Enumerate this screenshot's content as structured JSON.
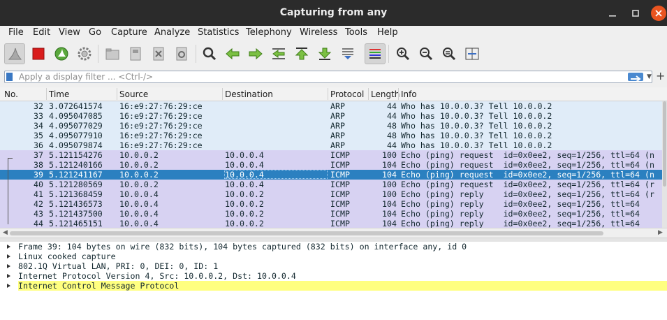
{
  "window": {
    "title": "Capturing from any"
  },
  "menu": [
    "File",
    "Edit",
    "View",
    "Go",
    "Capture",
    "Analyze",
    "Statistics",
    "Telephony",
    "Wireless",
    "Tools",
    "Help"
  ],
  "toolbar": {
    "icons": [
      "shark-fin-start-icon",
      "stop-square-icon",
      "restart-shark-icon",
      "capture-options-gear-icon",
      "open-folder-icon",
      "save-file-icon",
      "close-file-icon",
      "reload-file-icon",
      "find-packet-icon",
      "go-back-icon",
      "go-forward-icon",
      "go-to-packet-icon",
      "go-first-icon",
      "go-last-icon",
      "autoscroll-icon",
      "colorize-icon",
      "zoom-in-icon",
      "zoom-out-icon",
      "zoom-normal-icon",
      "resize-columns-icon"
    ],
    "accent_green": "#5aa83c",
    "accent_red": "#d91c1c"
  },
  "filter": {
    "placeholder": "Apply a display filter ... <Ctrl-/>"
  },
  "packet_list": {
    "columns": [
      "No.",
      "Time",
      "Source",
      "Destination",
      "Protocol",
      "Length",
      "Info"
    ],
    "rows": [
      {
        "no": "32",
        "time": "3.072641574",
        "src": "16:e9:27:76:29:ce",
        "dst": "",
        "proto": "ARP",
        "len": "44",
        "info": "Who has 10.0.0.3? Tell 10.0.0.2",
        "kind": "arp"
      },
      {
        "no": "33",
        "time": "4.095047085",
        "src": "16:e9:27:76:29:ce",
        "dst": "",
        "proto": "ARP",
        "len": "44",
        "info": "Who has 10.0.0.3? Tell 10.0.0.2",
        "kind": "arp"
      },
      {
        "no": "34",
        "time": "4.095077029",
        "src": "16:e9:27:76:29:ce",
        "dst": "",
        "proto": "ARP",
        "len": "48",
        "info": "Who has 10.0.0.3? Tell 10.0.0.2",
        "kind": "arp"
      },
      {
        "no": "35",
        "time": "4.095077910",
        "src": "16:e9:27:76:29:ce",
        "dst": "",
        "proto": "ARP",
        "len": "48",
        "info": "Who has 10.0.0.3? Tell 10.0.0.2",
        "kind": "arp"
      },
      {
        "no": "36",
        "time": "4.095079874",
        "src": "16:e9:27:76:29:ce",
        "dst": "",
        "proto": "ARP",
        "len": "44",
        "info": "Who has 10.0.0.3? Tell 10.0.0.2",
        "kind": "arp"
      },
      {
        "no": "37",
        "time": "5.121154276",
        "src": "10.0.0.2",
        "dst": "10.0.0.4",
        "proto": "ICMP",
        "len": "100",
        "info": "Echo (ping) request  id=0x0ee2, seq=1/256, ttl=64 (n",
        "kind": "icmp"
      },
      {
        "no": "38",
        "time": "5.121240166",
        "src": "10.0.0.2",
        "dst": "10.0.0.4",
        "proto": "ICMP",
        "len": "104",
        "info": "Echo (ping) request  id=0x0ee2, seq=1/256, ttl=64 (n",
        "kind": "icmp"
      },
      {
        "no": "39",
        "time": "5.121241167",
        "src": "10.0.0.2",
        "dst": "10.0.0.4",
        "proto": "ICMP",
        "len": "104",
        "info": "Echo (ping) request  id=0x0ee2, seq=1/256, ttl=64 (n",
        "kind": "sel"
      },
      {
        "no": "40",
        "time": "5.121280569",
        "src": "10.0.0.2",
        "dst": "10.0.0.4",
        "proto": "ICMP",
        "len": "100",
        "info": "Echo (ping) request  id=0x0ee2, seq=1/256, ttl=64 (r",
        "kind": "icmp"
      },
      {
        "no": "41",
        "time": "5.121368459",
        "src": "10.0.0.4",
        "dst": "10.0.0.2",
        "proto": "ICMP",
        "len": "100",
        "info": "Echo (ping) reply    id=0x0ee2, seq=1/256, ttl=64 (r",
        "kind": "icmp"
      },
      {
        "no": "42",
        "time": "5.121436573",
        "src": "10.0.0.4",
        "dst": "10.0.0.2",
        "proto": "ICMP",
        "len": "104",
        "info": "Echo (ping) reply    id=0x0ee2, seq=1/256, ttl=64",
        "kind": "icmp"
      },
      {
        "no": "43",
        "time": "5.121437500",
        "src": "10.0.0.4",
        "dst": "10.0.0.2",
        "proto": "ICMP",
        "len": "104",
        "info": "Echo (ping) reply    id=0x0ee2, seq=1/256, ttl=64",
        "kind": "icmp"
      },
      {
        "no": "44",
        "time": "5.121465151",
        "src": "10.0.0.4",
        "dst": "10.0.0.2",
        "proto": "ICMP",
        "len": "104",
        "info": "Echo (ping) reply    id=0x0ee2, seq=1/256, ttl=64",
        "kind": "icmp"
      }
    ],
    "colors": {
      "arp": "#e0ecf8",
      "icmp": "#d7d2f2",
      "selected": "#2b80c0"
    }
  },
  "details": [
    {
      "text": "Frame 39: 104 bytes on wire (832 bits), 104 bytes captured (832 bits) on interface any, id 0",
      "highlight": false
    },
    {
      "text": "Linux cooked capture",
      "highlight": false
    },
    {
      "text": "802.1Q Virtual LAN, PRI: 0, DEI: 0, ID: 1",
      "highlight": false
    },
    {
      "text": "Internet Protocol Version 4, Src: 10.0.0.2, Dst: 10.0.0.4",
      "highlight": false
    },
    {
      "text": "Internet Control Message Protocol",
      "highlight": true
    }
  ]
}
